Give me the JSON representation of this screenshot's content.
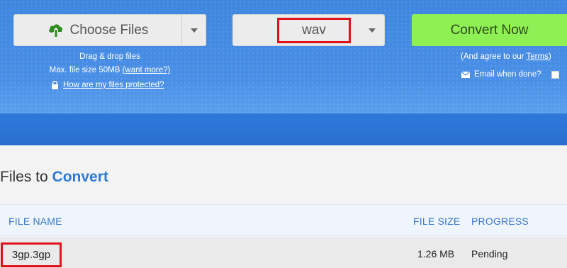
{
  "toolbar": {
    "choose_files_label": "Choose Files",
    "format_value": "wav",
    "convert_label": "Convert Now"
  },
  "upload_info": {
    "drag_drop": "Drag & drop files",
    "max_size": "Max. file size 50MB",
    "want_more": "(want more?)",
    "protected_link": "How are my files protected?"
  },
  "convert_options": {
    "agree_prefix": "(And agree to our ",
    "terms_link": "Terms",
    "agree_suffix": ")",
    "email_label": "Email when done?"
  },
  "files_section": {
    "title_prefix": "Files to",
    "title_accent": "Convert"
  },
  "table": {
    "headers": [
      "FILE NAME",
      "FILE SIZE",
      "PROGRESS"
    ],
    "rows": [
      {
        "file_name": "3gp.3gp",
        "file_size": "1.26 MB",
        "progress": "Pending"
      }
    ]
  },
  "colors": {
    "brand_blue": "#2d7ad6",
    "convert_green": "#8ef055",
    "highlight_red": "#e0121b"
  }
}
